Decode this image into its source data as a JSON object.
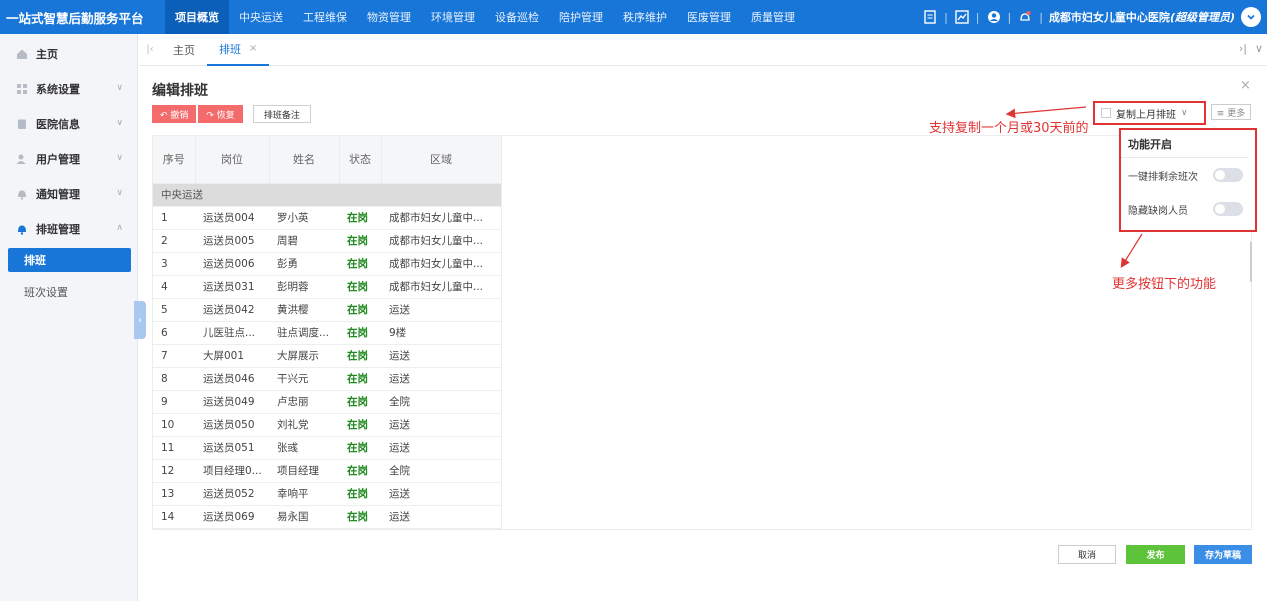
{
  "topbar": {
    "brand": "一站式智慧后勤服务平台",
    "nav": [
      "项目概览",
      "中央运送",
      "工程维保",
      "物资管理",
      "环境管理",
      "设备巡检",
      "陪护管理",
      "秩序维护",
      "医废管理",
      "质量管理"
    ],
    "sep": "|",
    "org_name": "成都市妇女儿童中心医院",
    "org_role": "(超级管理员)"
  },
  "sidebar": {
    "items": [
      {
        "label": "主页"
      },
      {
        "label": "系统设置"
      },
      {
        "label": "医院信息"
      },
      {
        "label": "用户管理"
      },
      {
        "label": "通知管理"
      },
      {
        "label": "排班管理"
      }
    ],
    "sub_items": [
      "排班",
      "班次设置"
    ]
  },
  "tabs": {
    "home": "主页",
    "schedule": "排班",
    "close": "×"
  },
  "editor": {
    "title": "编辑排班",
    "close": "×",
    "undo_label": "↶ 撤销",
    "redo_label": "↷ 恢复",
    "notes_label": "排班备注",
    "copy_last_month": "复制上月排班",
    "more_label": "≡ 更多"
  },
  "table": {
    "headers": [
      "序号",
      "岗位",
      "姓名",
      "状态",
      "区域"
    ],
    "group": "中央运送",
    "rows": [
      [
        "1",
        "运送员004",
        "罗小英",
        "在岗",
        "成都市妇女儿童中..."
      ],
      [
        "2",
        "运送员005",
        "周碧",
        "在岗",
        "成都市妇女儿童中..."
      ],
      [
        "3",
        "运送员006",
        "彭勇",
        "在岗",
        "成都市妇女儿童中..."
      ],
      [
        "4",
        "运送员031",
        "彭明蓉",
        "在岗",
        "成都市妇女儿童中..."
      ],
      [
        "5",
        "运送员042",
        "黄洪樱",
        "在岗",
        "运送"
      ],
      [
        "6",
        "儿医驻点...",
        "驻点调度...",
        "在岗",
        "9楼"
      ],
      [
        "7",
        "大屏001",
        "大屏展示",
        "在岗",
        "运送"
      ],
      [
        "8",
        "运送员046",
        "干兴元",
        "在岗",
        "运送"
      ],
      [
        "9",
        "运送员049",
        "卢忠丽",
        "在岗",
        "全院"
      ],
      [
        "10",
        "运送员050",
        "刘礼党",
        "在岗",
        "运送"
      ],
      [
        "11",
        "运送员051",
        "张彧",
        "在岗",
        "运送"
      ],
      [
        "12",
        "项目经理0...",
        "项目经理",
        "在岗",
        "全院"
      ],
      [
        "13",
        "运送员052",
        "幸响平",
        "在岗",
        "运送"
      ],
      [
        "14",
        "运送员069",
        "易永国",
        "在岗",
        "运送"
      ]
    ]
  },
  "more_panel": {
    "title": "功能开启",
    "options": [
      {
        "label": "一键排剩余班次",
        "on": false
      },
      {
        "label": "隐藏缺岗人员",
        "on": false
      }
    ]
  },
  "annotations": {
    "copy_note": "支持复制一个月或30天前的",
    "more_note": "更多按钮下的功能"
  },
  "footer": {
    "cancel": "取消",
    "publish": "发布",
    "draft": "存为草稿"
  },
  "colors": {
    "primary": "#1976d9",
    "danger": "#f36b6b",
    "annotation": "#e03333",
    "success": "#5cc33a",
    "on_duty": "#1f8a1f"
  }
}
